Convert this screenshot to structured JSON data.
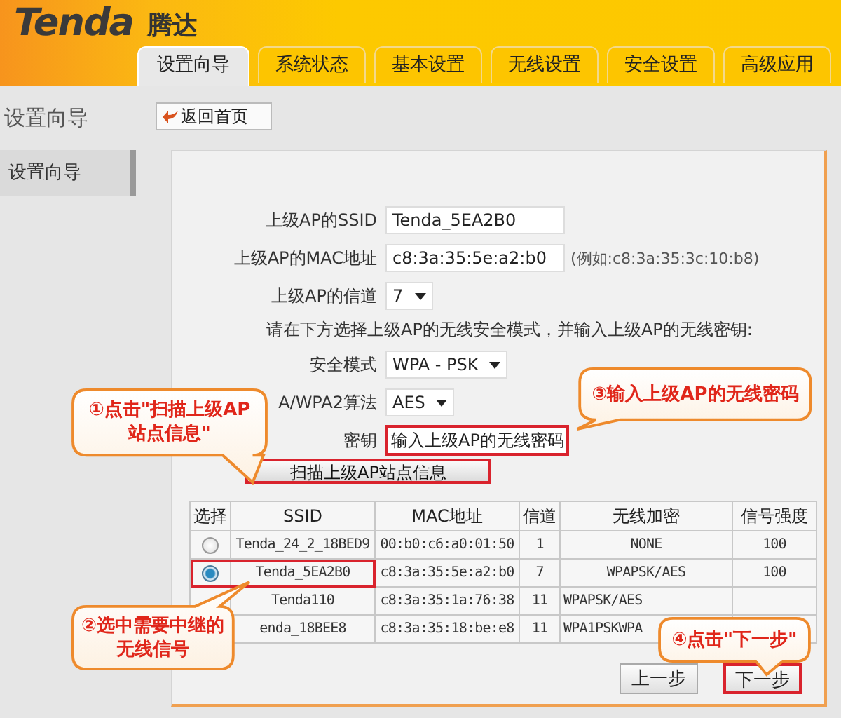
{
  "logo": {
    "brand": "Tenda",
    "name": "腾达"
  },
  "tabs": [
    {
      "label": "设置向导",
      "selected": true
    },
    {
      "label": "系统状态",
      "selected": false
    },
    {
      "label": "基本设置",
      "selected": false
    },
    {
      "label": "无线设置",
      "selected": false
    },
    {
      "label": "安全设置",
      "selected": false
    },
    {
      "label": "高级应用",
      "selected": false
    }
  ],
  "page_title": "设置向导",
  "back_button": "返回首页",
  "sidebar": {
    "items": [
      {
        "label": "设置向导",
        "selected": true
      }
    ]
  },
  "form": {
    "fields": [
      {
        "kind": "text",
        "label": "上级AP的SSID",
        "value": "Tenda_5EA2B0",
        "highlighted": false
      },
      {
        "kind": "text",
        "label": "上级AP的MAC地址",
        "value": "c8:3a:35:5e:a2:b0",
        "hint": "(例如:c8:3a:35:3c:10:b8)",
        "highlighted": false
      },
      {
        "kind": "select",
        "label": "上级AP的信道",
        "value": "7"
      },
      {
        "kind": "note",
        "text": "请在下方选择上级AP的无线安全模式，并输入上级AP的无线密钥:"
      },
      {
        "kind": "select",
        "label": "安全模式",
        "value": "WPA - PSK"
      },
      {
        "kind": "select",
        "label": "A/WPA2算法",
        "value": "AES"
      },
      {
        "kind": "text",
        "label": "密钥",
        "value": "输入上级AP的无线密码",
        "highlighted": true
      }
    ],
    "scan_button": {
      "label": "扫描上级AP站点信息",
      "highlighted": true
    }
  },
  "table": {
    "columns": [
      "选择",
      "SSID",
      "MAC地址",
      "信道",
      "无线加密",
      "信号强度"
    ],
    "rows": [
      {
        "selected": false,
        "highlighted": false,
        "cells": [
          "",
          "Tenda_24_2_18BED9",
          "00:b0:c6:a0:01:50",
          "1",
          "NONE",
          "100"
        ]
      },
      {
        "selected": true,
        "highlighted": true,
        "cells": [
          "",
          "Tenda_5EA2B0",
          "c8:3a:35:5e:a2:b0",
          "7",
          "WPAPSK/AES",
          "100"
        ]
      },
      {
        "highlighted": false,
        "cells": [
          "",
          "Tenda110",
          "c8:3a:35:1a:76:38",
          "11",
          "WPAPSK/AES"
        ]
      },
      {
        "highlighted": false,
        "cells": [
          "",
          "enda_18BEE8",
          "c8:3a:35:18:be:e8",
          "11",
          "WPA1PSKWPA"
        ]
      }
    ]
  },
  "buttons": [
    {
      "label": "上一步",
      "highlighted": false
    },
    {
      "label": "下一步",
      "highlighted": true
    }
  ],
  "callouts": [
    {
      "text": "①点击\"扫描上级AP站点信息\""
    },
    {
      "text": "③输入上级AP的无线密码"
    },
    {
      "text": "②选中需要中继的无线信号"
    },
    {
      "text": "④点击\"下一步\""
    }
  ]
}
